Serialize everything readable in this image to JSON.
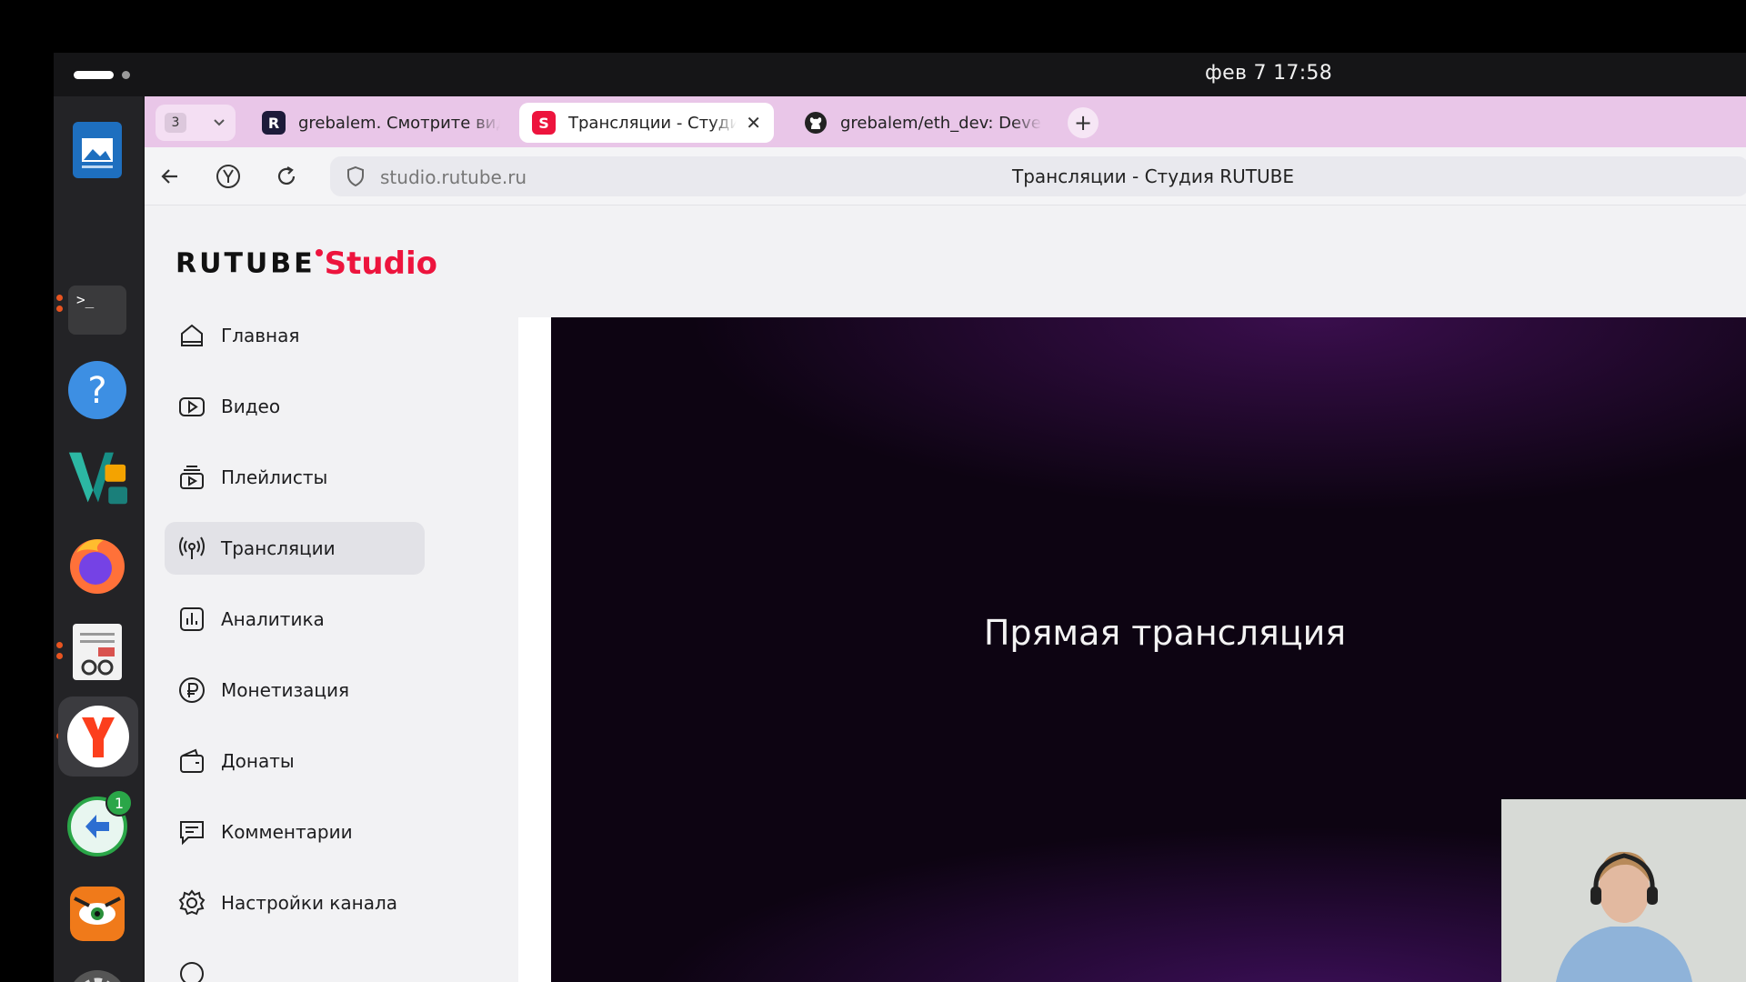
{
  "system": {
    "clock": "фев 7  17:58"
  },
  "dock": {
    "items": [
      {
        "name": "libreoffice-impress",
        "running": false,
        "active": false
      },
      {
        "name": "terminal",
        "running": true,
        "active": false
      },
      {
        "name": "help",
        "running": false,
        "active": false
      },
      {
        "name": "vscode-like",
        "running": false,
        "active": false
      },
      {
        "name": "firefox",
        "running": false,
        "active": false
      },
      {
        "name": "reader",
        "running": true,
        "active": false
      },
      {
        "name": "yandex-browser",
        "running": true,
        "active": true
      },
      {
        "name": "remote-desktop",
        "running": false,
        "active": false,
        "badge": "1"
      },
      {
        "name": "tiger-app",
        "running": false,
        "active": false
      },
      {
        "name": "settings",
        "running": true,
        "active": false
      }
    ]
  },
  "browser": {
    "tab_count": "3",
    "tabs": [
      {
        "title": "grebalem. Смотрите виде",
        "favicon": "R",
        "active": false
      },
      {
        "title": "Трансляции - Студия RUTUBE",
        "favicon": "S",
        "active": true
      },
      {
        "title": "grebalem/eth_dev: Develop",
        "favicon": "github",
        "active": false
      }
    ],
    "url": "studio.rutube.ru",
    "page_title": "Трансляции - Студия RUTUBE"
  },
  "studio": {
    "logo_main": "RUTUBE",
    "logo_sub": "Studio",
    "menu": [
      {
        "label": "Главная",
        "icon": "home-icon",
        "active": false
      },
      {
        "label": "Видео",
        "icon": "video-icon",
        "active": false
      },
      {
        "label": "Плейлисты",
        "icon": "playlists-icon",
        "active": false
      },
      {
        "label": "Трансляции",
        "icon": "broadcast-icon",
        "active": true
      },
      {
        "label": "Аналитика",
        "icon": "analytics-icon",
        "active": false
      },
      {
        "label": "Монетизация",
        "icon": "ruble-icon",
        "active": false
      },
      {
        "label": "Донаты",
        "icon": "wallet-icon",
        "active": false
      },
      {
        "label": "Комментарии",
        "icon": "comments-icon",
        "active": false
      },
      {
        "label": "Настройки канала",
        "icon": "gear-icon",
        "active": false
      }
    ],
    "hero_title": "Прямая трансляция"
  },
  "colors": {
    "brand_pink": "#ed143d",
    "tabstrip": "#e9c6e8",
    "hero_bg": "#0d0412"
  }
}
